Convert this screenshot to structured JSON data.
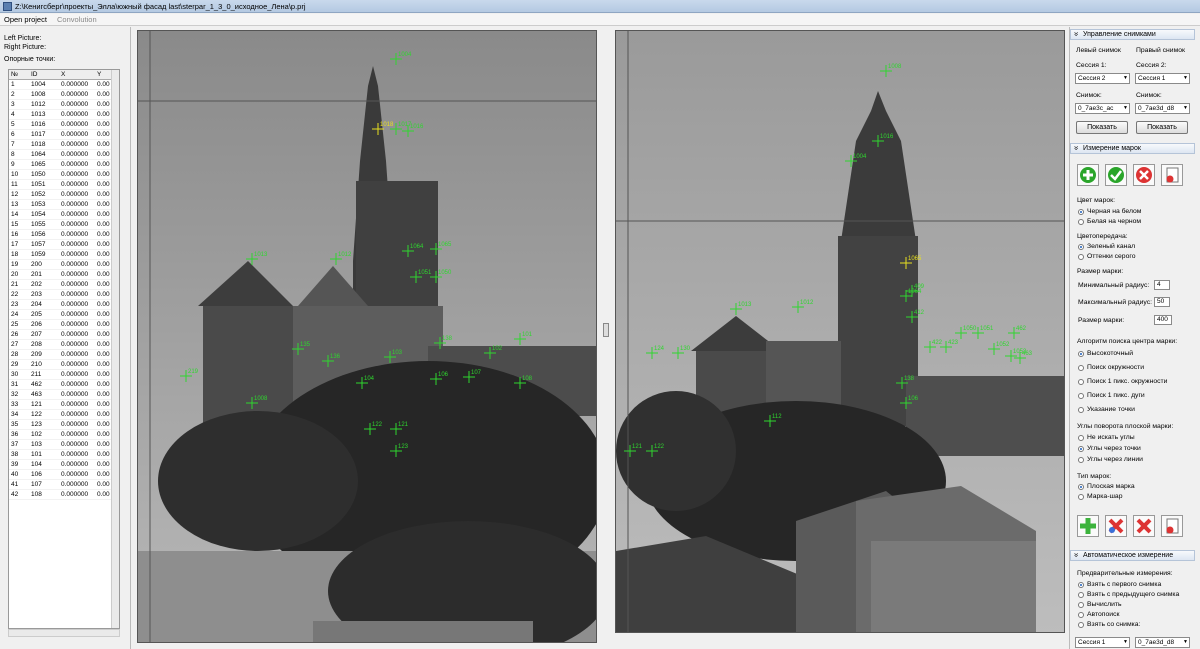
{
  "window": {
    "title": "Z:\\Кенигсберг\\проекты_Элла\\южный фасад last\\sterpar_1_3_0_исходное_Лена\\p.prj"
  },
  "menu": {
    "open_project": "Open project",
    "convolution": "Convolution"
  },
  "left": {
    "left_picture": "Left Picture:",
    "right_picture": "Right Picture:",
    "ref_points": "Опорные точки:",
    "columns": [
      "№",
      "ID",
      "X",
      "Y"
    ],
    "rows": [
      [
        "1",
        "1004",
        "0.000000",
        "0.00"
      ],
      [
        "2",
        "1008",
        "0.000000",
        "0.00"
      ],
      [
        "3",
        "1012",
        "0.000000",
        "0.00"
      ],
      [
        "4",
        "1013",
        "0.000000",
        "0.00"
      ],
      [
        "5",
        "1016",
        "0.000000",
        "0.00"
      ],
      [
        "6",
        "1017",
        "0.000000",
        "0.00"
      ],
      [
        "7",
        "1018",
        "0.000000",
        "0.00"
      ],
      [
        "8",
        "1064",
        "0.000000",
        "0.00"
      ],
      [
        "9",
        "1065",
        "0.000000",
        "0.00"
      ],
      [
        "10",
        "1050",
        "0.000000",
        "0.00"
      ],
      [
        "11",
        "1051",
        "0.000000",
        "0.00"
      ],
      [
        "12",
        "1052",
        "0.000000",
        "0.00"
      ],
      [
        "13",
        "1053",
        "0.000000",
        "0.00"
      ],
      [
        "14",
        "1054",
        "0.000000",
        "0.00"
      ],
      [
        "15",
        "1055",
        "0.000000",
        "0.00"
      ],
      [
        "16",
        "1056",
        "0.000000",
        "0.00"
      ],
      [
        "17",
        "1057",
        "0.000000",
        "0.00"
      ],
      [
        "18",
        "1059",
        "0.000000",
        "0.00"
      ],
      [
        "19",
        "200",
        "0.000000",
        "0.00"
      ],
      [
        "20",
        "201",
        "0.000000",
        "0.00"
      ],
      [
        "21",
        "202",
        "0.000000",
        "0.00"
      ],
      [
        "22",
        "203",
        "0.000000",
        "0.00"
      ],
      [
        "23",
        "204",
        "0.000000",
        "0.00"
      ],
      [
        "24",
        "205",
        "0.000000",
        "0.00"
      ],
      [
        "25",
        "206",
        "0.000000",
        "0.00"
      ],
      [
        "26",
        "207",
        "0.000000",
        "0.00"
      ],
      [
        "27",
        "208",
        "0.000000",
        "0.00"
      ],
      [
        "28",
        "209",
        "0.000000",
        "0.00"
      ],
      [
        "29",
        "210",
        "0.000000",
        "0.00"
      ],
      [
        "30",
        "211",
        "0.000000",
        "0.00"
      ],
      [
        "31",
        "462",
        "0.000000",
        "0.00"
      ],
      [
        "32",
        "463",
        "0.000000",
        "0.00"
      ],
      [
        "33",
        "121",
        "0.000000",
        "0.00"
      ],
      [
        "34",
        "122",
        "0.000000",
        "0.00"
      ],
      [
        "35",
        "123",
        "0.000000",
        "0.00"
      ],
      [
        "36",
        "102",
        "0.000000",
        "0.00"
      ],
      [
        "37",
        "103",
        "0.000000",
        "0.00"
      ],
      [
        "38",
        "101",
        "0.000000",
        "0.00"
      ],
      [
        "39",
        "104",
        "0.000000",
        "0.00"
      ],
      [
        "40",
        "106",
        "0.000000",
        "0.00"
      ],
      [
        "41",
        "107",
        "0.000000",
        "0.00"
      ],
      [
        "42",
        "108",
        "0.000000",
        "0.00"
      ]
    ]
  },
  "markers": {
    "left": [
      "1004",
      "1013",
      "1012",
      "1016",
      "1017",
      "1018",
      "1064",
      "1065",
      "1050",
      "1051",
      "101",
      "102",
      "103",
      "104",
      "106",
      "107",
      "108",
      "121",
      "122",
      "123",
      "135",
      "136",
      "138",
      "219",
      "1008"
    ],
    "right": [
      "1008",
      "1016",
      "1004",
      "1013",
      "1012",
      "1065",
      "1064",
      "1050",
      "1051",
      "1052",
      "1053",
      "124",
      "130",
      "112",
      "121",
      "122",
      "138",
      "106",
      "409",
      "412",
      "422",
      "423",
      "462",
      "463"
    ]
  },
  "panel": {
    "sec1": "Управление снимками",
    "left_shot": "Левый снимок",
    "right_shot": "Правый снимок",
    "session1": "Сессия 1:",
    "session2": "Сессия 2:",
    "session1_val": "Сессия 2",
    "session2_val": "Сессия 1",
    "shot1": "Снимок:",
    "shot2": "Снимок:",
    "shot1_val": "0_7ae3c_ac",
    "shot2_val": "0_7ae3d_d8",
    "show": "Показать",
    "sec2": "Измерение марок",
    "color_title": "Цвет марок:",
    "color_opts": [
      "Черная на белом",
      "Белая на черном"
    ],
    "transfer_title": "Цветопередача:",
    "transfer_opts": [
      "Зеленый канал",
      "Оттенки серого"
    ],
    "size_title": "Размер марки:",
    "min_r": "Минимальный радиус:",
    "min_r_val": "4",
    "max_r": "Максимальный радиус:",
    "max_r_val": "50",
    "mark_size": "Размер марки:",
    "mark_size_val": "400",
    "algo_title": "Алгоритм поиска центра марки:",
    "algo_opts": [
      "Высокоточный",
      "Поиск окружности",
      "Поиск 1 пикс. окружности",
      "Поиск 1 пикс. дуги",
      "Указание точки"
    ],
    "angle_title": "Углы поворота плоской марки:",
    "angle_opts": [
      "Не искать углы",
      "Углы через точки",
      "Углы через линии"
    ],
    "type_title": "Тип марок:",
    "type_opts": [
      "Плоская марка",
      "Марка-шар"
    ],
    "sec3": "Автоматическое измерение",
    "pre_title": "Предварительные измерения:",
    "pre_opts": [
      "Взять с первого снимка",
      "Взять с предыдущего снимка",
      "Вычислить",
      "Автопоиск",
      "Взять со снимка:"
    ],
    "bottom_session": "Сессия 1",
    "bottom_shot": "0_7ae3d_d8"
  },
  "colors": {
    "marker": "#2fd62f",
    "marker_sel": "#e8e020",
    "accent": "#1d5fbf"
  }
}
